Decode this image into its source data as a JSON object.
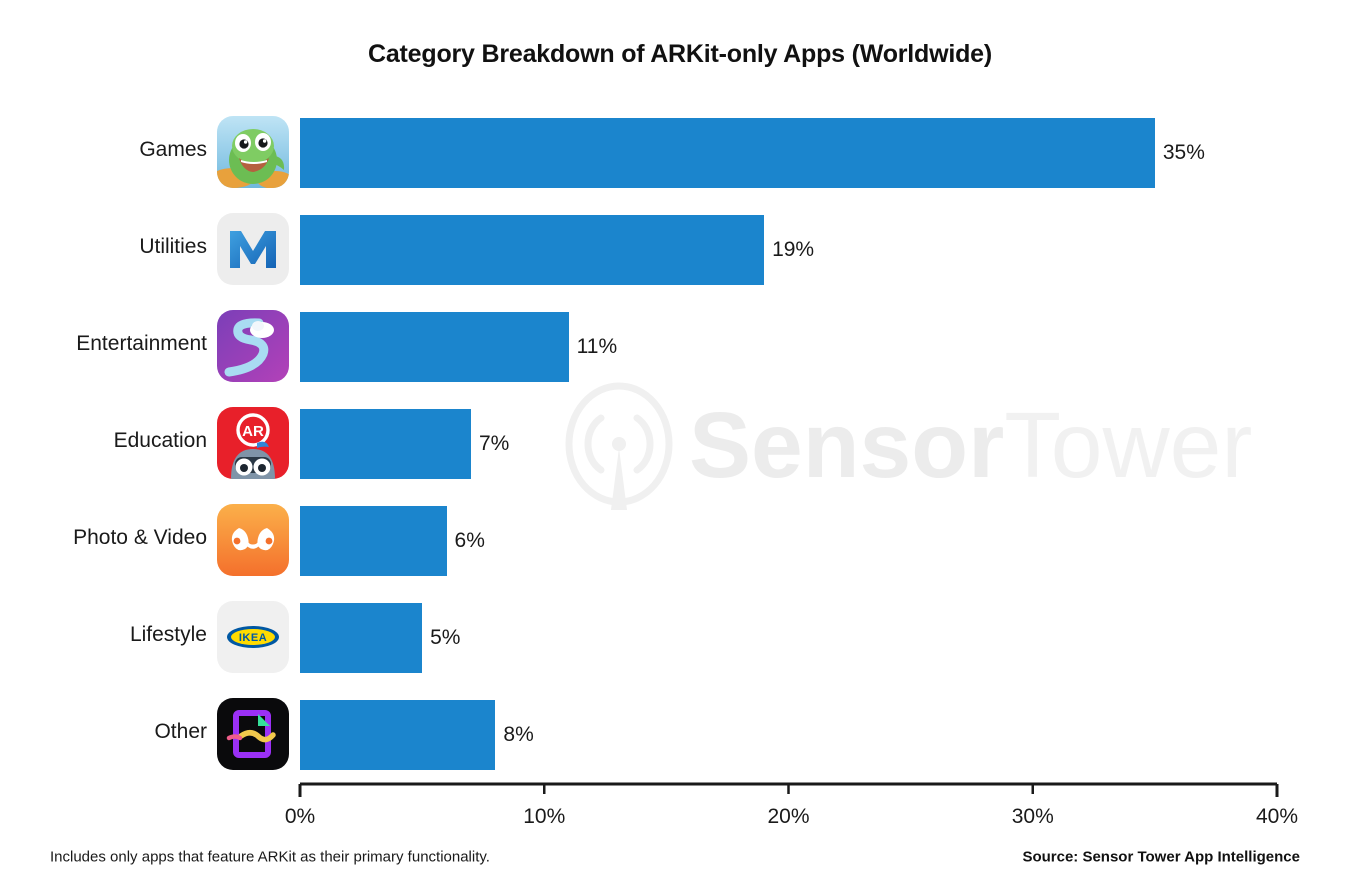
{
  "chart_data": {
    "type": "bar",
    "orientation": "horizontal",
    "title": "Category Breakdown of ARKit-only Apps (Worldwide)",
    "xlabel": "",
    "ylabel": "",
    "xlim": [
      0,
      40
    ],
    "grid": false,
    "legend": null,
    "bar_color": "#1b85cd",
    "categories": [
      "Games",
      "Utilities",
      "Entertainment",
      "Education",
      "Photo & Video",
      "Lifestyle",
      "Other"
    ],
    "values": [
      35,
      19,
      11,
      7,
      6,
      5,
      8
    ],
    "value_labels": [
      "35%",
      "19%",
      "11%",
      "7%",
      "6%",
      "5%",
      "8%"
    ],
    "tick_values": [
      0,
      10,
      20,
      30,
      40
    ],
    "tick_labels": [
      "0%",
      "10%",
      "20%",
      "30%",
      "40%"
    ],
    "icons": [
      "games-dinosaur-app-icon",
      "utilities-measurekit-m-app-icon",
      "entertainment-purple-road-app-icon",
      "education-ar-robot-app-icon",
      "photo-video-orange-face-app-icon",
      "lifestyle-ikea-app-icon",
      "other-neon-frame-app-icon"
    ]
  },
  "footer": {
    "note": "Includes only apps that feature ARKit as their primary functionality.",
    "source": "Source: Sensor Tower App Intelligence"
  },
  "watermark": {
    "brand_bold": "Sensor",
    "brand_light": "Tower"
  }
}
